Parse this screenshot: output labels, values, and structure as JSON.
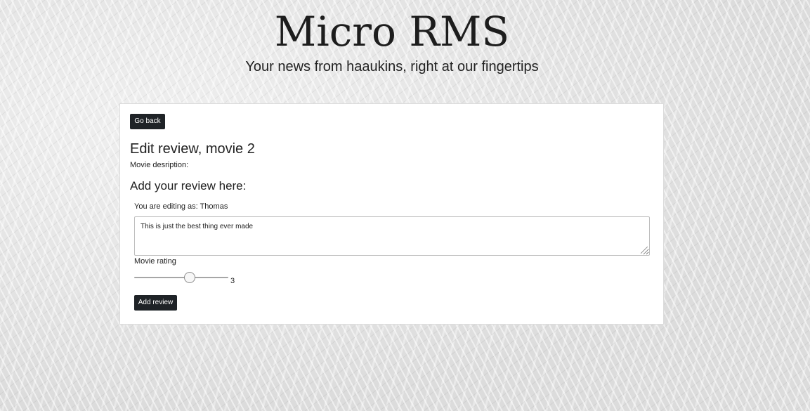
{
  "header": {
    "title": "Micro RMS",
    "subtitle": "Your news from haaukins, right at our fingertips"
  },
  "panel": {
    "go_back_label": "Go back",
    "heading": "Edit review, movie 2",
    "description_label": "Movie desription:",
    "description_value": "",
    "add_review_heading": "Add your review here:",
    "editing_as_label": "You are editing as:",
    "editing_as_user": "Thomas",
    "review_text": "This is just the best thing ever made",
    "rating_label": "Movie rating",
    "rating": {
      "min": 0,
      "max": 5,
      "value": 3,
      "display": "3"
    },
    "submit_label": "Add review"
  },
  "colors": {
    "button_bg": "#1f2327",
    "button_text": "#ffffff",
    "panel_bg": "#ffffff",
    "page_bg": "#e6e6e6"
  }
}
